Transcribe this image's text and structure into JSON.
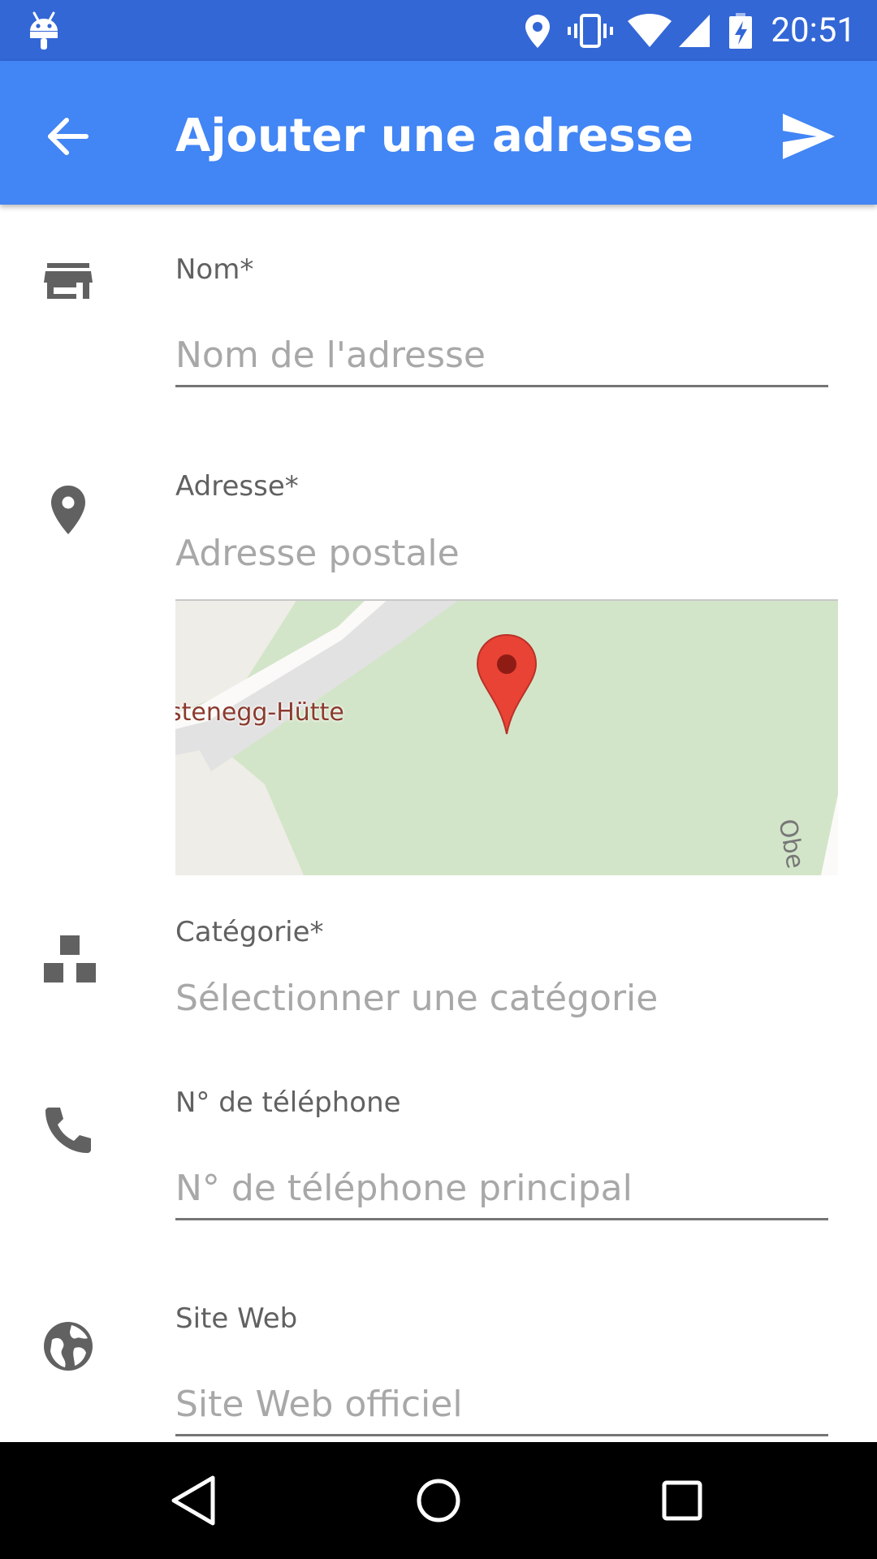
{
  "status_bar": {
    "time": "20:51",
    "icons": [
      "android-debug-icon",
      "location-icon",
      "vibrate-icon",
      "wifi-icon",
      "signal-icon",
      "battery-charging-icon"
    ]
  },
  "app_bar": {
    "title": "Ajouter une adresse",
    "back_icon": "arrow-back-icon",
    "send_icon": "send-icon"
  },
  "form": {
    "name": {
      "label": "Nom*",
      "placeholder": "Nom de l'adresse",
      "icon": "store-icon"
    },
    "address": {
      "label": "Adresse*",
      "placeholder": "Adresse postale",
      "icon": "place-icon",
      "map": {
        "place_label": "stenegg-Hütte",
        "road_label": "Obe"
      }
    },
    "category": {
      "label": "Catégorie*",
      "placeholder": "Sélectionner une catégorie",
      "icon": "category-icon"
    },
    "phone": {
      "label": "N° de téléphone",
      "placeholder": "N° de téléphone principal",
      "icon": "phone-icon"
    },
    "website": {
      "label": "Site Web",
      "placeholder": "Site Web officiel",
      "icon": "globe-icon"
    }
  },
  "nav_bar": {
    "icons": [
      "nav-back-icon",
      "nav-home-icon",
      "nav-recents-icon"
    ]
  },
  "colors": {
    "status_bar": "#3367d6",
    "app_bar": "#4285f4",
    "map_park": "#d3e5c9",
    "map_pin": "#e94335"
  }
}
